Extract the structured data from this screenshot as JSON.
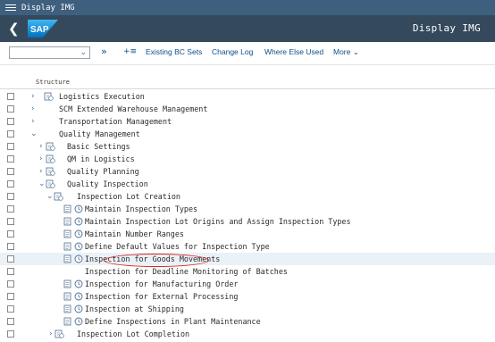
{
  "window": {
    "title": "Display IMG"
  },
  "header": {
    "title": "Display IMG",
    "logo_text": "SAP"
  },
  "toolbar": {
    "existing_bc_sets": "Existing BC Sets",
    "change_log": "Change Log",
    "where_else_used": "Where Else Used",
    "more": "More"
  },
  "tree": {
    "column_header": "Structure",
    "rows": [
      {
        "label": "Logistics Execution",
        "expanded": false,
        "type": "folder"
      },
      {
        "label": "SCM Extended Warehouse Management",
        "expanded": false,
        "type": "node"
      },
      {
        "label": "Transportation Management",
        "expanded": false,
        "type": "node"
      },
      {
        "label": "Quality Management",
        "expanded": true,
        "type": "node"
      },
      {
        "label": "Basic Settings",
        "expanded": false,
        "type": "folder"
      },
      {
        "label": "QM in Logistics",
        "expanded": false,
        "type": "folder"
      },
      {
        "label": "Quality Planning",
        "expanded": false,
        "type": "folder"
      },
      {
        "label": "Quality Inspection",
        "expanded": true,
        "type": "folder"
      },
      {
        "label": "Inspection Lot Creation",
        "expanded": true,
        "type": "folder"
      },
      {
        "label": "Maintain Inspection Types",
        "type": "activity"
      },
      {
        "label": "Maintain Inspection Lot Origins and Assign Inspection Types",
        "type": "activity"
      },
      {
        "label": "Maintain Number Ranges",
        "type": "activity"
      },
      {
        "label": "Define Default Values for Inspection Type",
        "type": "activity"
      },
      {
        "label": "Inspection for Goods Movements",
        "type": "activity",
        "selected": true
      },
      {
        "label": "Inspection for Deadline Monitoring of Batches",
        "type": "activity"
      },
      {
        "label": "Inspection for Manufacturing Order",
        "type": "activity"
      },
      {
        "label": "Inspection for External Processing",
        "type": "activity"
      },
      {
        "label": "Inspection at Shipping",
        "type": "activity"
      },
      {
        "label": "Define Inspections in Plant Maintenance",
        "type": "activity"
      },
      {
        "label": "Inspection Lot Completion",
        "expanded": false,
        "type": "folder"
      }
    ]
  },
  "colors": {
    "shell": "#34495c",
    "titlebar": "#3f5f7e",
    "link": "#0a4e8c",
    "highlight": "#d9231e"
  }
}
